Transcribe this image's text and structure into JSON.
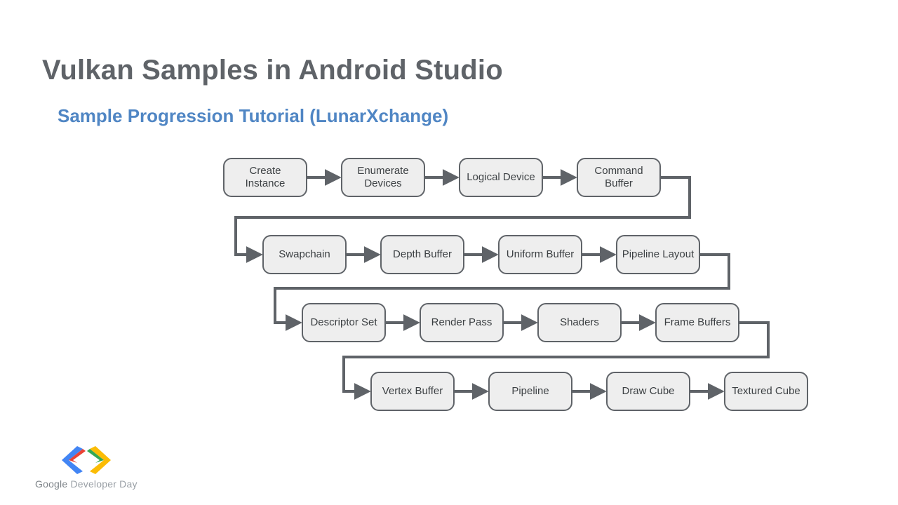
{
  "title": "Vulkan Samples in Android Studio",
  "subtitle": "Sample Progression Tutorial (LunarXchange)",
  "nodes": {
    "n0": "Create Instance",
    "n1": "Enumerate Devices",
    "n2": "Logical Device",
    "n3": "Command Buffer",
    "n4": "Swapchain",
    "n5": "Depth Buffer",
    "n6": "Uniform Buffer",
    "n7": "Pipeline Layout",
    "n8": "Descriptor Set",
    "n9": "Render Pass",
    "n10": "Shaders",
    "n11": "Frame Buffers",
    "n12": "Vertex Buffer",
    "n13": "Pipeline",
    "n14": "Draw Cube",
    "n15": "Textured Cube"
  },
  "footer": {
    "brand": "Google",
    "rest": " Developer Day"
  },
  "chart_data": {
    "type": "area",
    "title": "Vulkan sample progression flowchart",
    "layout": "snake-left-to-right-then-wrap-down",
    "rows": [
      [
        "Create Instance",
        "Enumerate Devices",
        "Logical Device",
        "Command Buffer"
      ],
      [
        "Swapchain",
        "Depth Buffer",
        "Uniform Buffer",
        "Pipeline Layout"
      ],
      [
        "Descriptor Set",
        "Render Pass",
        "Shaders",
        "Frame Buffers"
      ],
      [
        "Vertex Buffer",
        "Pipeline",
        "Draw Cube",
        "Textured Cube"
      ]
    ],
    "edges": [
      [
        "Create Instance",
        "Enumerate Devices"
      ],
      [
        "Enumerate Devices",
        "Logical Device"
      ],
      [
        "Logical Device",
        "Command Buffer"
      ],
      [
        "Command Buffer",
        "Swapchain"
      ],
      [
        "Swapchain",
        "Depth Buffer"
      ],
      [
        "Depth Buffer",
        "Uniform Buffer"
      ],
      [
        "Uniform Buffer",
        "Pipeline Layout"
      ],
      [
        "Pipeline Layout",
        "Descriptor Set"
      ],
      [
        "Descriptor Set",
        "Render Pass"
      ],
      [
        "Render Pass",
        "Shaders"
      ],
      [
        "Shaders",
        "Frame Buffers"
      ],
      [
        "Frame Buffers",
        "Vertex Buffer"
      ],
      [
        "Vertex Buffer",
        "Pipeline"
      ],
      [
        "Pipeline",
        "Draw Cube"
      ],
      [
        "Draw Cube",
        "Textured Cube"
      ]
    ]
  }
}
